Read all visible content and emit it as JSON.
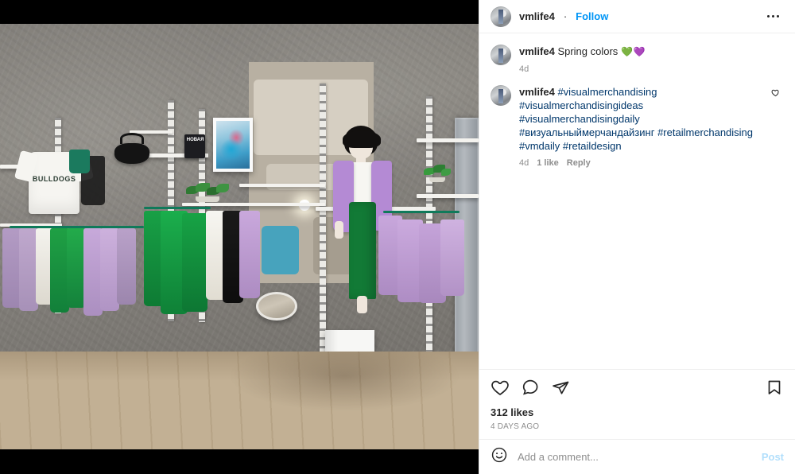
{
  "header": {
    "username": "vmlife4",
    "separator": "·",
    "follow_label": "Follow",
    "menu_icon": "more-options-icon",
    "avatar_icon": "avatar"
  },
  "caption": {
    "username": "vmlife4",
    "text": "Spring colors",
    "emojis": "💚💜",
    "timestamp": "4d"
  },
  "comment": {
    "username": "vmlife4",
    "text": "#visualmerchandising #visualmerchandisingideas #visualmerchandisingdaily #визуальныймерчандайзинг #retailmerchandising #vmdaily #retaildesign",
    "hashtags": [
      "#visualmerchandising",
      "#visualmerchandisingideas",
      "#visualmerchandisingdaily",
      "#визуальныймерчандайзинг",
      "#retailmerchandising",
      "#vmdaily",
      "#retaildesign"
    ],
    "timestamp": "4d",
    "likes": "1 like",
    "reply_label": "Reply",
    "like_icon": "heart-icon"
  },
  "actions": {
    "like_icon": "heart-icon",
    "comment_icon": "comment-icon",
    "share_icon": "share-icon",
    "save_icon": "bookmark-icon",
    "likes_count": "312 likes",
    "posted_ago": "4 DAYS AGO"
  },
  "add_comment": {
    "emoji_icon": "emoji-smiley-icon",
    "placeholder": "Add a comment...",
    "value": "",
    "post_label": "Post"
  },
  "media": {
    "alt": "Retail store visual merchandising display with spring colors",
    "tee_print": "BULLDOGS",
    "poster_text": "НОВАЯ",
    "colors": {
      "lilac": "#b48ad4",
      "green": "#127a36",
      "wall": "#83807a",
      "floor": "#c2b094",
      "link_blue": "#0095f6",
      "tag_blue": "#00376b",
      "muted": "#8e8e8e"
    }
  }
}
